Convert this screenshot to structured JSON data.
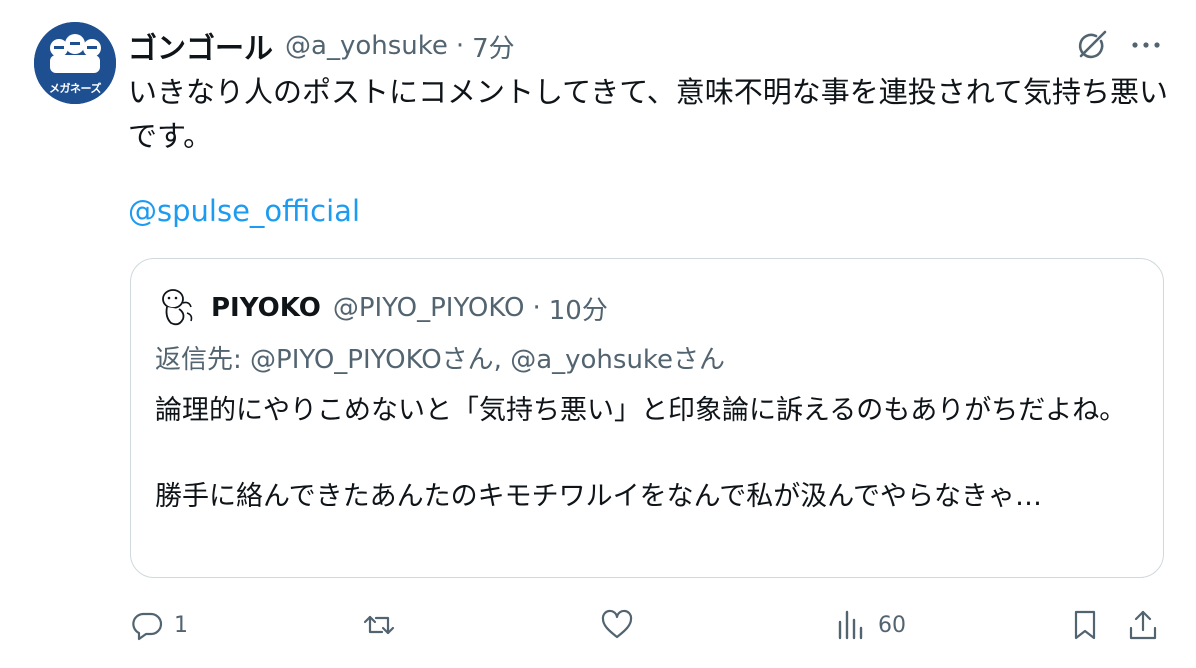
{
  "author": {
    "name": "ゴンゴール",
    "handle": "@a_yohsuke",
    "separator": "·",
    "time": "7分",
    "avatar_label": "メガネーズ"
  },
  "tweet": {
    "text": "いきなり人のポストにコメントしてきて、意味不明な事を連投されて気持ち悪いです。",
    "mention": "@spulse_official"
  },
  "quote": {
    "name": "PIYOKO",
    "handle": "@PIYO_PIYOKO",
    "separator": "·",
    "time": "10分",
    "reply_to": "返信先: @PIYO_PIYOKOさん, @a_yohsukeさん",
    "text": "論理的にやりこめないと「気持ち悪い」と印象論に訴えるのもありがちだよね。\n\n勝手に絡んできたあんたのキモチワルイをなんで私が汲んでやらなきゃ…"
  },
  "actions": {
    "reply_count": "1",
    "repost_count": "",
    "like_count": "",
    "views_count": "60"
  },
  "icons": {
    "reply": "reply-icon",
    "repost": "repost-icon",
    "like": "heart-icon",
    "views": "views-icon",
    "bookmark": "bookmark-icon",
    "share": "share-icon",
    "grok": "grok-icon",
    "more": "more-icon"
  },
  "colors": {
    "link": "#1d9bf0",
    "secondary_text": "#536471",
    "border": "#cfd9de",
    "avatar_bg": "#1d4f91"
  }
}
